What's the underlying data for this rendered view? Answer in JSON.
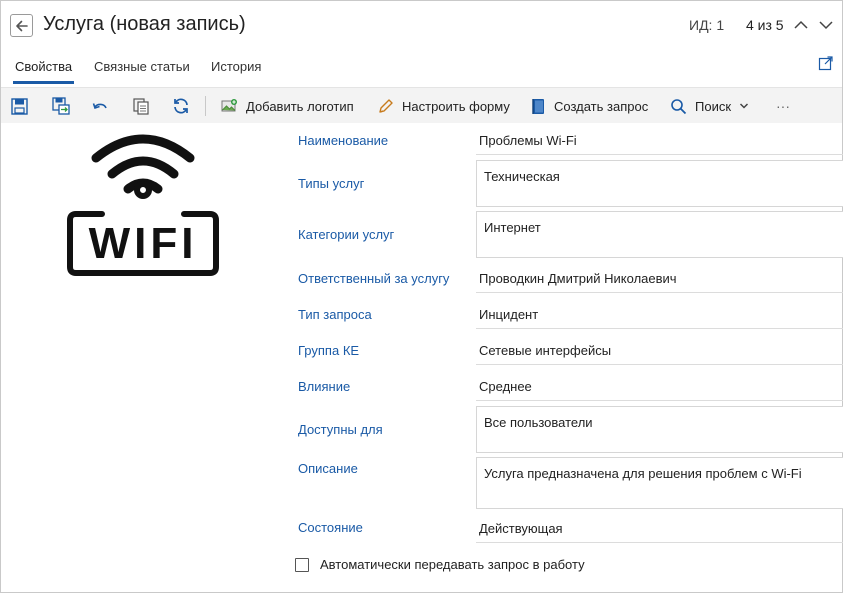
{
  "header": {
    "title": "Услуга (новая запись)",
    "id_label": "ИД: 1",
    "position": "4 из 5"
  },
  "tabs": [
    {
      "label": "Свойства",
      "active": true
    },
    {
      "label": "Связные статьи",
      "active": false
    },
    {
      "label": "История",
      "active": false
    }
  ],
  "toolbar": {
    "add_logo": "Добавить логотип",
    "configure_form": "Настроить форму",
    "create_request": "Создать запрос",
    "search": "Поиск",
    "more": "···"
  },
  "logo": {
    "text": "WIFI",
    "icon": "wifi-icon"
  },
  "form": {
    "name": {
      "label": "Наименование",
      "value": "Проблемы Wi-Fi"
    },
    "service_types": {
      "label": "Типы услуг",
      "value": "Техническая"
    },
    "service_categories": {
      "label": "Категории услуг",
      "value": "Интернет"
    },
    "responsible": {
      "label": "Ответственный за услугу",
      "value": "Проводкин Дмитрий Николаевич"
    },
    "request_type": {
      "label": "Тип запроса",
      "value": "Инцидент"
    },
    "ke_group": {
      "label": "Группа КЕ",
      "value": "Сетевые интерфейсы"
    },
    "impact": {
      "label": "Влияние",
      "value": "Среднее"
    },
    "available_for": {
      "label": "Доступны для",
      "value": "Все пользователи"
    },
    "description": {
      "label": "Описание",
      "value": "Услуга предназначена для решения проблем с Wi-Fi"
    },
    "state": {
      "label": "Состояние",
      "value": "Действующая"
    },
    "auto_transfer": {
      "label": "Автоматически передавать запрос в работу",
      "checked": false
    }
  },
  "colors": {
    "accent": "#1a5aa6",
    "toolbar_bg": "#f3f3f3",
    "label": "#1a5aa6"
  }
}
